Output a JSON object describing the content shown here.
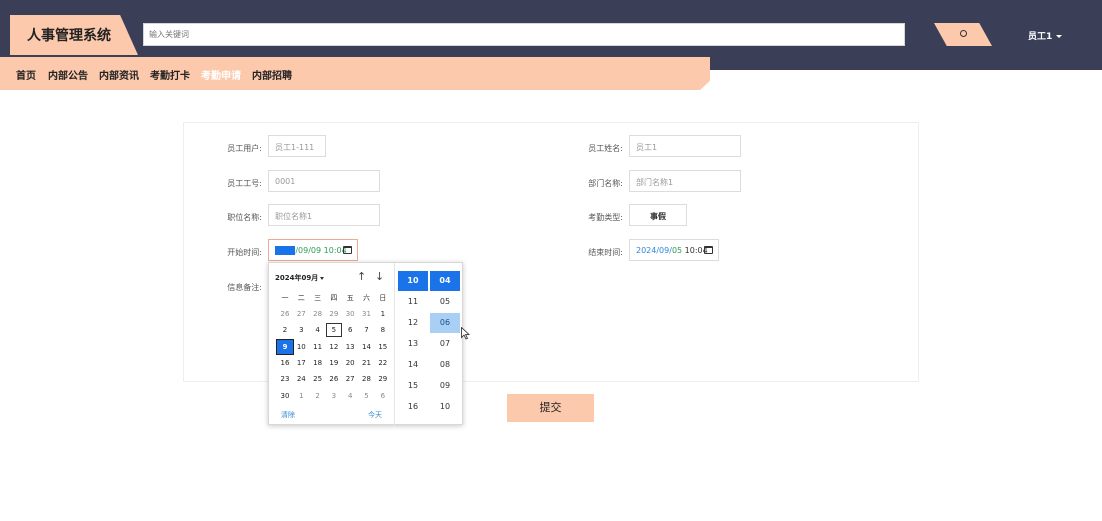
{
  "header": {
    "app_title": "人事管理系统",
    "search_placeholder": "输入关键词",
    "user_label": "员工1"
  },
  "nav": [
    "首页",
    "内部公告",
    "内部资讯",
    "考勤打卡",
    "考勤申请",
    "内部招聘"
  ],
  "form": {
    "user_label": "员工用户:",
    "user_value": "员工1-111",
    "name_label": "员工姓名:",
    "name_value": "员工1",
    "id_label": "员工工号:",
    "id_value": "0001",
    "dept_label": "部门名称:",
    "dept_value": "部门名称1",
    "position_label": "职位名称:",
    "position_value": "职位名称1",
    "type_label": "考勤类型:",
    "type_value": "事假",
    "start_label": "开始时间:",
    "start_rest": "/09/09 10:04",
    "end_label": "结束时间:",
    "end_year": "2024",
    "end_mid": "/09/",
    "end_day": "05",
    "end_time": " 10:04",
    "remark_label": "信息备注:",
    "submit_label": "提交"
  },
  "picker": {
    "month_label": "2024年09月",
    "weekdays": [
      "一",
      "二",
      "三",
      "四",
      "五",
      "六",
      "日"
    ],
    "days": [
      [
        "26",
        "27",
        "28",
        "29",
        "30",
        "31",
        "1"
      ],
      [
        "2",
        "3",
        "4",
        "5",
        "6",
        "7",
        "8"
      ],
      [
        "9",
        "10",
        "11",
        "12",
        "13",
        "14",
        "15"
      ],
      [
        "16",
        "17",
        "18",
        "19",
        "20",
        "21",
        "22"
      ],
      [
        "23",
        "24",
        "25",
        "26",
        "27",
        "28",
        "29"
      ],
      [
        "30",
        "1",
        "2",
        "3",
        "4",
        "5",
        "6"
      ]
    ],
    "clear_label": "清除",
    "today_label": "今天",
    "hours": [
      "10",
      "11",
      "12",
      "13",
      "14",
      "15",
      "16"
    ],
    "minutes": [
      "04",
      "05",
      "06",
      "07",
      "08",
      "09",
      "10"
    ]
  }
}
